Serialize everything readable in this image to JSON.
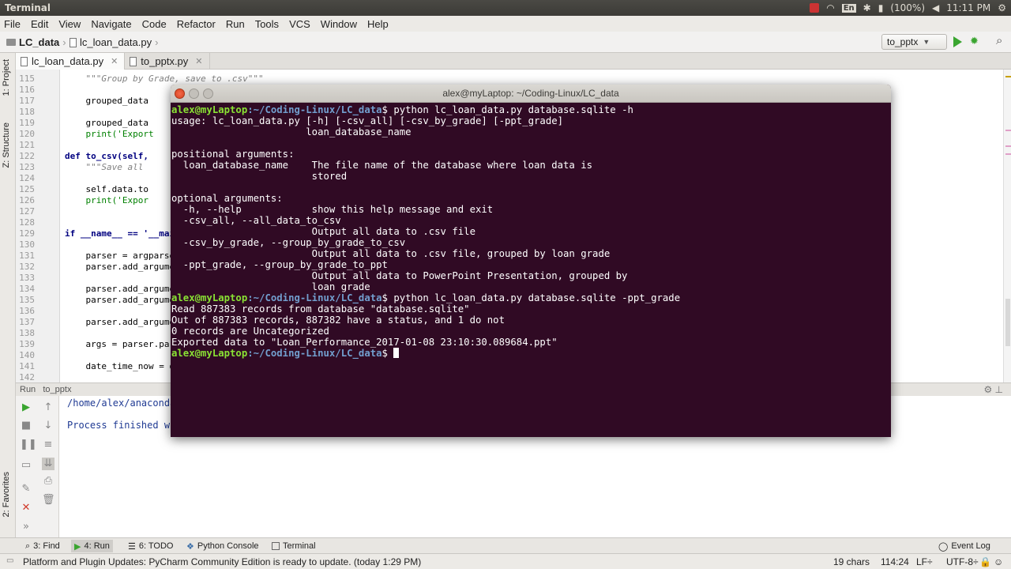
{
  "topbar": {
    "app_title": "Terminal",
    "battery": "(100%)",
    "time": "11:11 PM",
    "lang": "En"
  },
  "menu": [
    "File",
    "Edit",
    "View",
    "Navigate",
    "Code",
    "Refactor",
    "Run",
    "Tools",
    "VCS",
    "Window",
    "Help"
  ],
  "nav": {
    "project": "LC_data",
    "file": "lc_loan_data.py",
    "run_config": "to_pptx"
  },
  "side_tabs": {
    "project": "1: Project",
    "structure": "Z: Structure",
    "favorites": "2: Favorites"
  },
  "tabs": [
    {
      "label": "lc_loan_data.py",
      "close": "✕"
    },
    {
      "label": "to_pptx.py",
      "close": "✕"
    }
  ],
  "editor": {
    "lines": [
      {
        "n": "115",
        "text": "    \"\"\"Group by Grade, save to .csv\"\"\"",
        "cls": "doc"
      },
      {
        "n": "116",
        "text": "",
        "cls": ""
      },
      {
        "n": "117",
        "text": "    grouped_data",
        "cls": ""
      },
      {
        "n": "118",
        "text": "",
        "cls": ""
      },
      {
        "n": "119",
        "text": "    grouped_data",
        "cls": ""
      },
      {
        "n": "120",
        "text": "    print('Export",
        "cls": "str"
      },
      {
        "n": "121",
        "text": "",
        "cls": ""
      },
      {
        "n": "122",
        "text": "def to_csv(self,",
        "cls": "kw"
      },
      {
        "n": "123",
        "text": "    \"\"\"Save all",
        "cls": "doc"
      },
      {
        "n": "124",
        "text": "",
        "cls": ""
      },
      {
        "n": "125",
        "text": "    self.data.to",
        "cls": ""
      },
      {
        "n": "126",
        "text": "    print('Expor",
        "cls": "str"
      },
      {
        "n": "127",
        "text": "",
        "cls": ""
      },
      {
        "n": "128",
        "text": "",
        "cls": ""
      },
      {
        "n": "129",
        "text": "if __name__ == '__mai",
        "cls": "kw"
      },
      {
        "n": "130",
        "text": "",
        "cls": ""
      },
      {
        "n": "131",
        "text": "    parser = argparse",
        "cls": ""
      },
      {
        "n": "132",
        "text": "    parser.add_argume",
        "cls": ""
      },
      {
        "n": "133",
        "text": "",
        "cls": ""
      },
      {
        "n": "134",
        "text": "    parser.add_argume",
        "cls": ""
      },
      {
        "n": "135",
        "text": "    parser.add_argume",
        "cls": ""
      },
      {
        "n": "136",
        "text": "",
        "cls": ""
      },
      {
        "n": "137",
        "text": "    parser.add_argume",
        "cls": ""
      },
      {
        "n": "138",
        "text": "",
        "cls": ""
      },
      {
        "n": "139",
        "text": "    args = parser.pa",
        "cls": ""
      },
      {
        "n": "140",
        "text": "",
        "cls": ""
      },
      {
        "n": "141",
        "text": "    date_time_now = d",
        "cls": ""
      },
      {
        "n": "142",
        "text": "",
        "cls": ""
      }
    ]
  },
  "run_panel": {
    "label": "Run",
    "config": "to_pptx",
    "console": [
      "/home/alex/anaconda3",
      "",
      "Process finished wit"
    ]
  },
  "terminal": {
    "title": "alex@myLaptop: ~/Coding-Linux/LC_data",
    "user": "alex@myLaptop",
    "path": ":~/Coding-Linux/LC_data",
    "cmd1": "$ python lc_loan_data.py database.sqlite -h",
    "help": [
      "usage: lc_loan_data.py [-h] [-csv_all] [-csv_by_grade] [-ppt_grade]",
      "                       loan_database_name",
      "",
      "positional arguments:",
      "  loan_database_name    The file name of the database where loan data is",
      "                        stored",
      "",
      "optional arguments:",
      "  -h, --help            show this help message and exit",
      "  -csv_all, --all_data_to_csv",
      "                        Output all data to .csv file",
      "  -csv_by_grade, --group_by_grade_to_csv",
      "                        Output all data to .csv file, grouped by loan grade",
      "  -ppt_grade, --group_by_grade_to_ppt",
      "                        Output all data to PowerPoint Presentation, grouped by",
      "                        loan grade"
    ],
    "cmd2": "$ python lc_loan_data.py database.sqlite -ppt_grade",
    "output": [
      "Read 887383 records from database \"database.sqlite\"",
      "Out of 887383 records, 887382 have a status, and 1 do not",
      "0 records are Uncategorized",
      "Exported data to \"Loan_Performance_2017-01-08 23:10:30.089684.ppt\""
    ],
    "prompt_end": "$ "
  },
  "tool_tabs": {
    "find": "3: Find",
    "run": "4: Run",
    "todo": "6: TODO",
    "python_console": "Python Console",
    "terminal": "Terminal",
    "event_log": "Event Log"
  },
  "status": {
    "message": "Platform and Plugin Updates: PyCharm Community Edition is ready to update. (today 1:29 PM)",
    "chars": "19 chars",
    "position": "114:24",
    "line_sep": "LF÷",
    "encoding": "UTF-8÷"
  }
}
